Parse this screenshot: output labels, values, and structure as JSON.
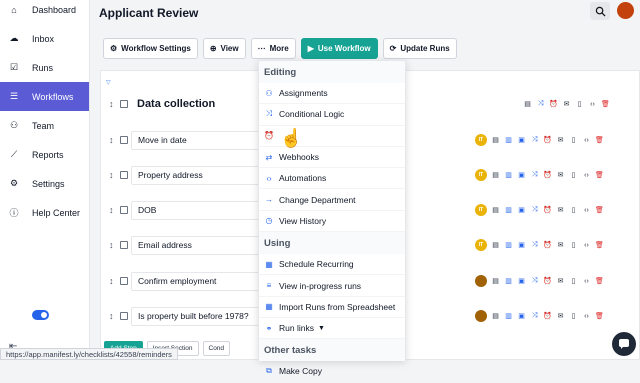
{
  "sidebar": {
    "items": [
      {
        "label": "Dashboard",
        "icon": "home-icon"
      },
      {
        "label": "Inbox",
        "icon": "inbox-icon"
      },
      {
        "label": "Runs",
        "icon": "check-square-icon"
      },
      {
        "label": "Workflows",
        "icon": "list-icon",
        "active": true
      },
      {
        "label": "Team",
        "icon": "team-icon"
      },
      {
        "label": "Reports",
        "icon": "chart-icon"
      },
      {
        "label": "Settings",
        "icon": "gear-icon"
      },
      {
        "label": "Help Center",
        "icon": "info-icon"
      }
    ]
  },
  "header": {
    "title": "Applicant Review"
  },
  "toolbar": {
    "workflow_settings": "Workflow Settings",
    "view": "View",
    "more": "More",
    "use_workflow": "Use Workflow",
    "update_runs": "Update Runs"
  },
  "sections": [
    {
      "label": "Data collection",
      "type": "header"
    },
    {
      "label": "Move in date"
    },
    {
      "label": "Property address"
    },
    {
      "label": "DOB"
    },
    {
      "label": "Email address"
    },
    {
      "label": "Confirm employment"
    },
    {
      "label": "Is property built before 1978?"
    }
  ],
  "bottom_buttons": {
    "add_step": "Add Step",
    "insert_section": "Insert Section",
    "conditions": "Cond"
  },
  "menu": {
    "editing_header": "Editing",
    "editing_items": [
      "Assignments",
      "Conditional Logic",
      "",
      "Webhooks",
      "Automations",
      "Change Department",
      "View History"
    ],
    "using_header": "Using",
    "using_items": [
      "Schedule Recurring",
      "View in-progress runs",
      "Import Runs from Spreadsheet",
      "Run links"
    ],
    "other_header": "Other tasks",
    "other_items": [
      "Make Copy"
    ]
  },
  "status_url": "https://app.manifest.ly/checklists/42558/reminders",
  "colors": {
    "accent": "#5b5bd6",
    "primary": "#16a394",
    "danger": "#dc2626",
    "link": "#2563eb"
  }
}
